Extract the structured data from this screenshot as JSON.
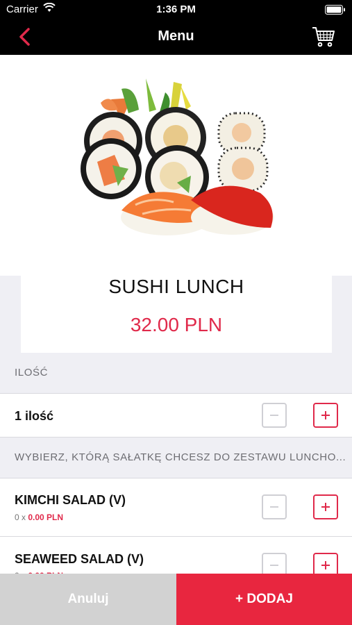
{
  "status_bar": {
    "carrier": "Carrier",
    "time": "1:36 PM"
  },
  "nav": {
    "title": "Menu",
    "back_icon": "chevron-left-icon",
    "cart_icon": "cart-icon"
  },
  "product": {
    "name": "SUSHI LUNCH",
    "price": "32.00 PLN",
    "image": "sushi-platter-image"
  },
  "quantity_section": {
    "header": "ILOŚĆ",
    "label": "1 ilość"
  },
  "salad_section": {
    "header": "WYBIERZ, KTÓRĄ SAŁATKĘ CHCESZ DO ZESTAWU LUNCHO...",
    "items": [
      {
        "name": "KIMCHI SALAD (V)",
        "qty": "0 x",
        "price": "0.00 PLN"
      },
      {
        "name": "SEAWEED SALAD (V)",
        "qty": "0 x",
        "price": "0.00 PLN"
      }
    ]
  },
  "actions": {
    "cancel": "Anuluj",
    "add": "+ DODAJ"
  },
  "colors": {
    "accent": "#e0294a",
    "nav_bg": "#000000",
    "cancel_bg": "#d2d2d2",
    "add_bg": "#e8263f"
  }
}
